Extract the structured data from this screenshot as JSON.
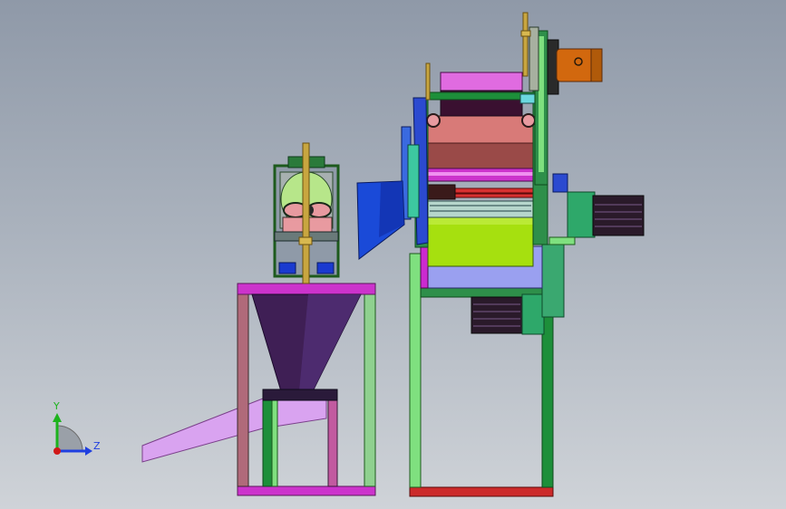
{
  "viewport": {
    "background_top": "#8f99a8",
    "background_bottom": "#cfd3d8"
  },
  "triad": {
    "y_label": "Y",
    "z_label": "Z",
    "y_color": "#1db31d",
    "z_color": "#1f3fe0",
    "x_color": "#d01818"
  },
  "parts": {
    "left_machine": {
      "frame_color": "#1d8f3a",
      "frame_highlight": "#7fe07f",
      "top_plate_color": "#cc33cc",
      "hopper_color": "#3f1f55",
      "chute_color": "#d9a3f0",
      "shaft_color": "#c8a640",
      "rotor_color": "#b7e68a",
      "block_color": "#e89aa0"
    },
    "right_machine": {
      "frame_color": "#1d8f3a",
      "top_roller_color": "#e06be0",
      "drum_color": "#d87a78",
      "drum_dark_color": "#9a4a48",
      "screen_color": "#b6d6cc",
      "cylinder_color": "#a6e00f",
      "tray_color": "#9aa0f0",
      "funnel_color": "#1a4ad8",
      "side_plate_color": "#2b4ad0",
      "motor_color": "#2a1a2a",
      "gearbox_color": "#2ea86a",
      "base_color": "#cc2a2a",
      "belt_guard_color": "#3dc8a0",
      "orange_motor_color": "#d2680e"
    }
  }
}
